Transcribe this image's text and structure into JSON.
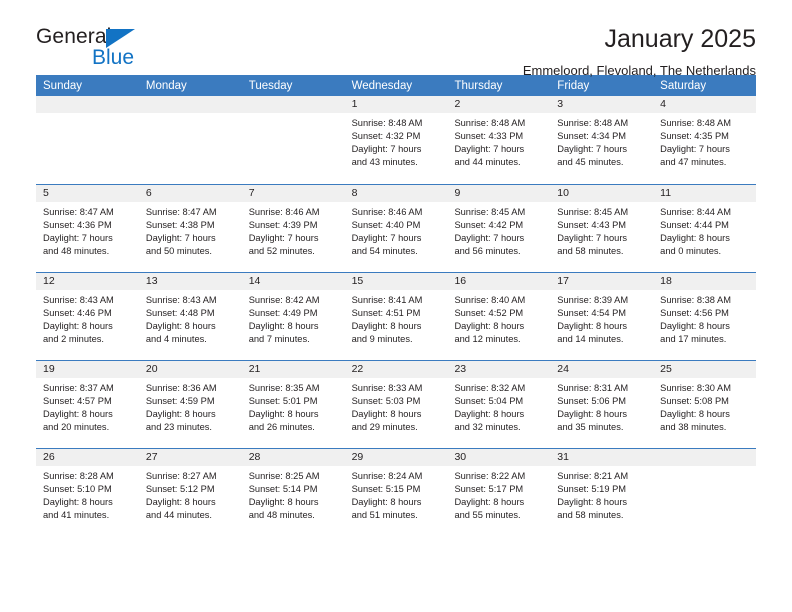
{
  "brand": {
    "name_top": "General",
    "name_bottom": "Blue",
    "accent_color": "#1273c4"
  },
  "header": {
    "title": "January 2025",
    "subtitle": "Emmeloord, Flevoland, The Netherlands"
  },
  "theme": {
    "header_blue": "#3b7bbf",
    "day_band_gray": "#f0f0f0",
    "text": "#231f20"
  },
  "weekday_headers": [
    "Sunday",
    "Monday",
    "Tuesday",
    "Wednesday",
    "Thursday",
    "Friday",
    "Saturday"
  ],
  "weeks": [
    [
      {
        "day": "",
        "sunrise": "",
        "sunset": "",
        "daylight_line1": "",
        "daylight_line2": ""
      },
      {
        "day": "",
        "sunrise": "",
        "sunset": "",
        "daylight_line1": "",
        "daylight_line2": ""
      },
      {
        "day": "",
        "sunrise": "",
        "sunset": "",
        "daylight_line1": "",
        "daylight_line2": ""
      },
      {
        "day": "1",
        "sunrise": "Sunrise: 8:48 AM",
        "sunset": "Sunset: 4:32 PM",
        "daylight_line1": "Daylight: 7 hours",
        "daylight_line2": "and 43 minutes."
      },
      {
        "day": "2",
        "sunrise": "Sunrise: 8:48 AM",
        "sunset": "Sunset: 4:33 PM",
        "daylight_line1": "Daylight: 7 hours",
        "daylight_line2": "and 44 minutes."
      },
      {
        "day": "3",
        "sunrise": "Sunrise: 8:48 AM",
        "sunset": "Sunset: 4:34 PM",
        "daylight_line1": "Daylight: 7 hours",
        "daylight_line2": "and 45 minutes."
      },
      {
        "day": "4",
        "sunrise": "Sunrise: 8:48 AM",
        "sunset": "Sunset: 4:35 PM",
        "daylight_line1": "Daylight: 7 hours",
        "daylight_line2": "and 47 minutes."
      }
    ],
    [
      {
        "day": "5",
        "sunrise": "Sunrise: 8:47 AM",
        "sunset": "Sunset: 4:36 PM",
        "daylight_line1": "Daylight: 7 hours",
        "daylight_line2": "and 48 minutes."
      },
      {
        "day": "6",
        "sunrise": "Sunrise: 8:47 AM",
        "sunset": "Sunset: 4:38 PM",
        "daylight_line1": "Daylight: 7 hours",
        "daylight_line2": "and 50 minutes."
      },
      {
        "day": "7",
        "sunrise": "Sunrise: 8:46 AM",
        "sunset": "Sunset: 4:39 PM",
        "daylight_line1": "Daylight: 7 hours",
        "daylight_line2": "and 52 minutes."
      },
      {
        "day": "8",
        "sunrise": "Sunrise: 8:46 AM",
        "sunset": "Sunset: 4:40 PM",
        "daylight_line1": "Daylight: 7 hours",
        "daylight_line2": "and 54 minutes."
      },
      {
        "day": "9",
        "sunrise": "Sunrise: 8:45 AM",
        "sunset": "Sunset: 4:42 PM",
        "daylight_line1": "Daylight: 7 hours",
        "daylight_line2": "and 56 minutes."
      },
      {
        "day": "10",
        "sunrise": "Sunrise: 8:45 AM",
        "sunset": "Sunset: 4:43 PM",
        "daylight_line1": "Daylight: 7 hours",
        "daylight_line2": "and 58 minutes."
      },
      {
        "day": "11",
        "sunrise": "Sunrise: 8:44 AM",
        "sunset": "Sunset: 4:44 PM",
        "daylight_line1": "Daylight: 8 hours",
        "daylight_line2": "and 0 minutes."
      }
    ],
    [
      {
        "day": "12",
        "sunrise": "Sunrise: 8:43 AM",
        "sunset": "Sunset: 4:46 PM",
        "daylight_line1": "Daylight: 8 hours",
        "daylight_line2": "and 2 minutes."
      },
      {
        "day": "13",
        "sunrise": "Sunrise: 8:43 AM",
        "sunset": "Sunset: 4:48 PM",
        "daylight_line1": "Daylight: 8 hours",
        "daylight_line2": "and 4 minutes."
      },
      {
        "day": "14",
        "sunrise": "Sunrise: 8:42 AM",
        "sunset": "Sunset: 4:49 PM",
        "daylight_line1": "Daylight: 8 hours",
        "daylight_line2": "and 7 minutes."
      },
      {
        "day": "15",
        "sunrise": "Sunrise: 8:41 AM",
        "sunset": "Sunset: 4:51 PM",
        "daylight_line1": "Daylight: 8 hours",
        "daylight_line2": "and 9 minutes."
      },
      {
        "day": "16",
        "sunrise": "Sunrise: 8:40 AM",
        "sunset": "Sunset: 4:52 PM",
        "daylight_line1": "Daylight: 8 hours",
        "daylight_line2": "and 12 minutes."
      },
      {
        "day": "17",
        "sunrise": "Sunrise: 8:39 AM",
        "sunset": "Sunset: 4:54 PM",
        "daylight_line1": "Daylight: 8 hours",
        "daylight_line2": "and 14 minutes."
      },
      {
        "day": "18",
        "sunrise": "Sunrise: 8:38 AM",
        "sunset": "Sunset: 4:56 PM",
        "daylight_line1": "Daylight: 8 hours",
        "daylight_line2": "and 17 minutes."
      }
    ],
    [
      {
        "day": "19",
        "sunrise": "Sunrise: 8:37 AM",
        "sunset": "Sunset: 4:57 PM",
        "daylight_line1": "Daylight: 8 hours",
        "daylight_line2": "and 20 minutes."
      },
      {
        "day": "20",
        "sunrise": "Sunrise: 8:36 AM",
        "sunset": "Sunset: 4:59 PM",
        "daylight_line1": "Daylight: 8 hours",
        "daylight_line2": "and 23 minutes."
      },
      {
        "day": "21",
        "sunrise": "Sunrise: 8:35 AM",
        "sunset": "Sunset: 5:01 PM",
        "daylight_line1": "Daylight: 8 hours",
        "daylight_line2": "and 26 minutes."
      },
      {
        "day": "22",
        "sunrise": "Sunrise: 8:33 AM",
        "sunset": "Sunset: 5:03 PM",
        "daylight_line1": "Daylight: 8 hours",
        "daylight_line2": "and 29 minutes."
      },
      {
        "day": "23",
        "sunrise": "Sunrise: 8:32 AM",
        "sunset": "Sunset: 5:04 PM",
        "daylight_line1": "Daylight: 8 hours",
        "daylight_line2": "and 32 minutes."
      },
      {
        "day": "24",
        "sunrise": "Sunrise: 8:31 AM",
        "sunset": "Sunset: 5:06 PM",
        "daylight_line1": "Daylight: 8 hours",
        "daylight_line2": "and 35 minutes."
      },
      {
        "day": "25",
        "sunrise": "Sunrise: 8:30 AM",
        "sunset": "Sunset: 5:08 PM",
        "daylight_line1": "Daylight: 8 hours",
        "daylight_line2": "and 38 minutes."
      }
    ],
    [
      {
        "day": "26",
        "sunrise": "Sunrise: 8:28 AM",
        "sunset": "Sunset: 5:10 PM",
        "daylight_line1": "Daylight: 8 hours",
        "daylight_line2": "and 41 minutes."
      },
      {
        "day": "27",
        "sunrise": "Sunrise: 8:27 AM",
        "sunset": "Sunset: 5:12 PM",
        "daylight_line1": "Daylight: 8 hours",
        "daylight_line2": "and 44 minutes."
      },
      {
        "day": "28",
        "sunrise": "Sunrise: 8:25 AM",
        "sunset": "Sunset: 5:14 PM",
        "daylight_line1": "Daylight: 8 hours",
        "daylight_line2": "and 48 minutes."
      },
      {
        "day": "29",
        "sunrise": "Sunrise: 8:24 AM",
        "sunset": "Sunset: 5:15 PM",
        "daylight_line1": "Daylight: 8 hours",
        "daylight_line2": "and 51 minutes."
      },
      {
        "day": "30",
        "sunrise": "Sunrise: 8:22 AM",
        "sunset": "Sunset: 5:17 PM",
        "daylight_line1": "Daylight: 8 hours",
        "daylight_line2": "and 55 minutes."
      },
      {
        "day": "31",
        "sunrise": "Sunrise: 8:21 AM",
        "sunset": "Sunset: 5:19 PM",
        "daylight_line1": "Daylight: 8 hours",
        "daylight_line2": "and 58 minutes."
      },
      {
        "day": "",
        "sunrise": "",
        "sunset": "",
        "daylight_line1": "",
        "daylight_line2": ""
      }
    ]
  ]
}
